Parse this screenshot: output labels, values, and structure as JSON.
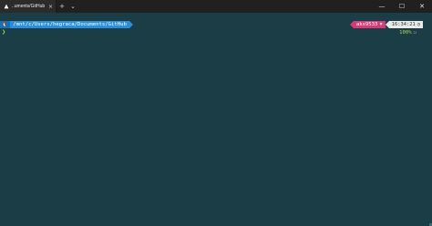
{
  "titlebar": {
    "tab_title": "..uments/GitHub",
    "tab_icon": "triangle-terminal-icon",
    "close_glyph": "×",
    "new_tab_glyph": "+",
    "dropdown_glyph": "⌄",
    "minimize_glyph": "—",
    "maximize_glyph": "☐",
    "window_close_glyph": "✕"
  },
  "terminal": {
    "os_segment": "🐧",
    "path": "/mnt/c/Users/hegraca/Documents/GitHub",
    "context": "aks9533",
    "context_icon": "⎈",
    "time": "16:34:21",
    "clock_icon": "◷",
    "prompt_char": "❯",
    "cpu_label": "100%",
    "status_glyph": "☐"
  },
  "colors": {
    "background": "#1b3d46",
    "path_segment": "#2a8ed8",
    "context_segment": "#d63a78",
    "time_segment": "#e9e9e9",
    "prompt": "#9ade4a"
  }
}
